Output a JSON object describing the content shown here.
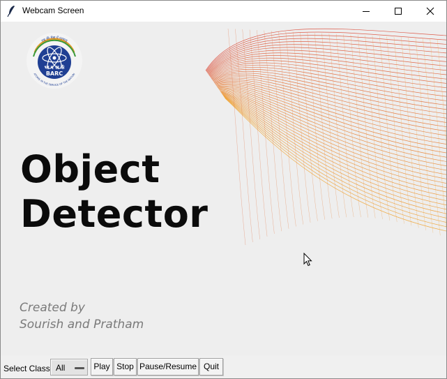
{
  "window": {
    "title": "Webcam Screen",
    "icon": "feather-icon",
    "controls": [
      "minimize-icon",
      "maximize-icon",
      "close-icon"
    ]
  },
  "logo": {
    "top_text": "राष्ट्र की सेवा में परमाणु",
    "bottom_text": "ATOMS IN THE SERVICE OF THE NATION",
    "hindi": "भा प अ कें",
    "name": "BARC"
  },
  "hero": {
    "line1": "Object",
    "line2": "Detector"
  },
  "credits": {
    "line1": "Created by",
    "line2": "Sourish and Pratham"
  },
  "controls": {
    "select_label": "Select Class:",
    "select_value": "All",
    "play": "Play",
    "stop": "Stop",
    "pause_resume": "Pause/Resume",
    "quit": "Quit"
  },
  "colors": {
    "wave_start": "#d9412e",
    "wave_end": "#f0a22b",
    "logo_blue": "#1f3f93"
  }
}
